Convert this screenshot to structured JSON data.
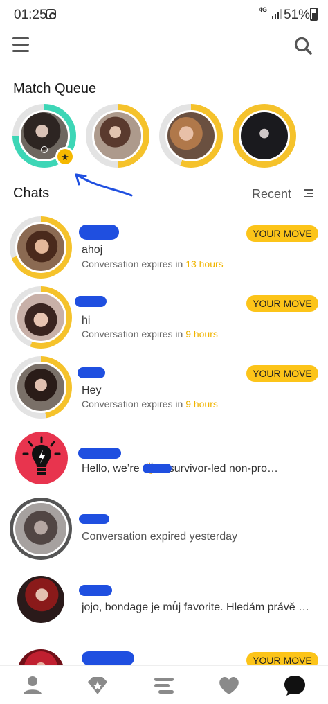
{
  "status_bar": {
    "time": "01:25",
    "network": "4G",
    "battery": "51%",
    "icons": [
      "instagram-icon",
      "signal-icon",
      "battery-icon"
    ]
  },
  "header": {
    "menu_icon": "hamburger-menu-icon",
    "search_icon": "search-icon"
  },
  "match_queue": {
    "title": "Match Queue",
    "items": [
      {
        "ring_color": "#3dd6b6",
        "progress": 0.75,
        "badge": "star-badge-icon"
      },
      {
        "ring_color": "#f5c22b",
        "progress": 0.5
      },
      {
        "ring_color": "#f5c22b",
        "progress": 0.55
      },
      {
        "ring_color": "#f5c22b",
        "progress": 1.0
      }
    ]
  },
  "chats": {
    "title": "Chats",
    "sort_label": "Recent",
    "sort_icon": "sort-lines-icon",
    "rows": [
      {
        "message": "ahoj",
        "expiry_prefix": "Conversation expires in ",
        "expiry_value": "13 hours",
        "action": "YOUR MOVE"
      },
      {
        "message": "hi",
        "expiry_prefix": "Conversation expires in ",
        "expiry_value": "9 hours",
        "action": "YOUR MOVE"
      },
      {
        "message": "Hey",
        "expiry_prefix": "Conversation expires in ",
        "expiry_value": "9 hours",
        "action": "YOUR MOVE"
      },
      {
        "message": "Hello, we’re       👋 a survivor-led non-pro…"
      },
      {
        "message": "Conversation expired yesterday"
      },
      {
        "message": "jojo, bondage je můj favorite. Hledám právě …"
      },
      {
        "action": "YOUR MOVE"
      }
    ]
  },
  "bottom_nav": {
    "items": [
      "profile-icon",
      "discover-diamond-icon",
      "swipe-icon",
      "likes-heart-icon",
      "chats-bubble-icon"
    ],
    "active": "chats-bubble-icon"
  },
  "colors": {
    "accent_yellow": "#fcc419",
    "teal": "#3dd6b6",
    "redaction_blue": "#1f4fe0",
    "highlight_text": "#f0b400"
  }
}
